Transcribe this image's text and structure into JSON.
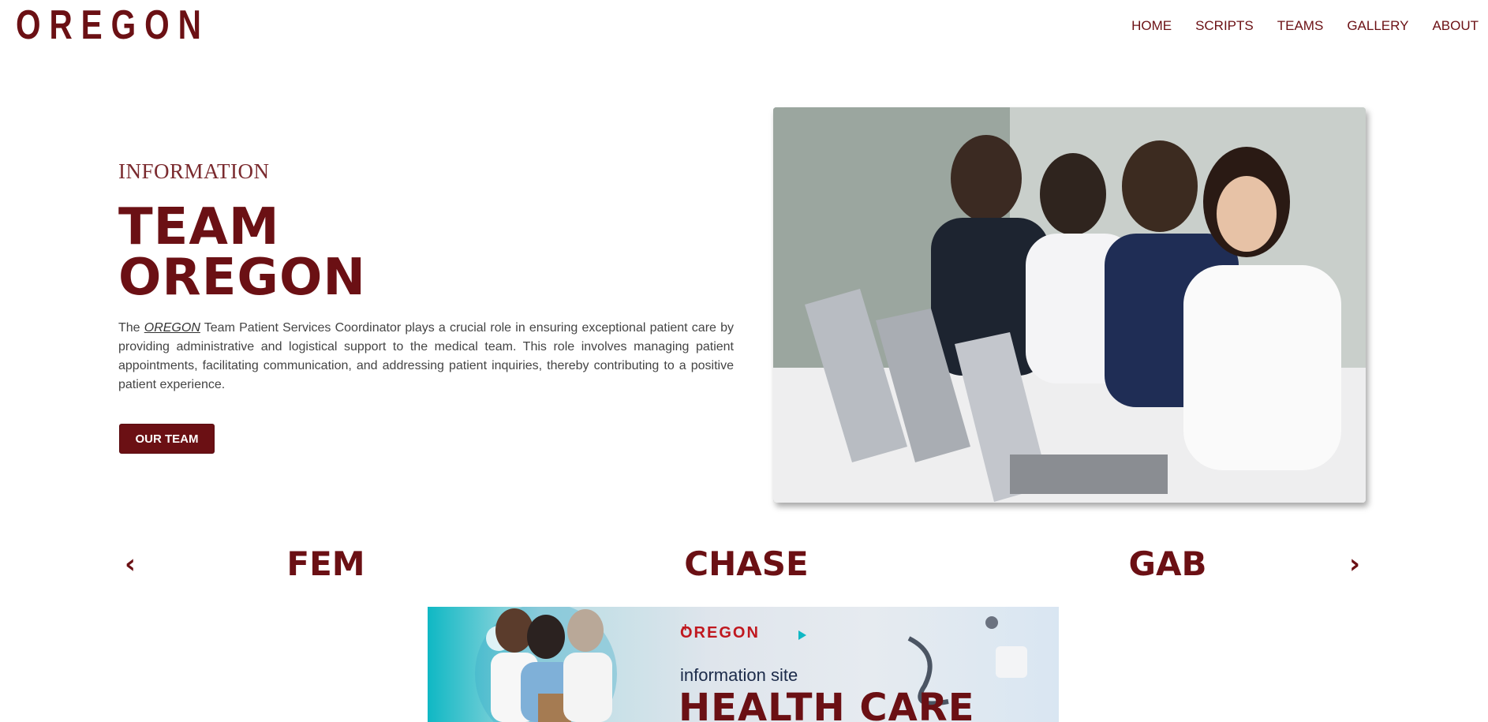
{
  "header": {
    "logo": "OREGON",
    "nav": [
      "HOME",
      "SCRIPTS",
      "TEAMS",
      "GALLERY",
      "ABOUT"
    ]
  },
  "hero": {
    "eyebrow": "INFORMATION",
    "title_line1": "TEAM",
    "title_line2": "OREGON",
    "desc_before": "The ",
    "desc_brand": "OREGON",
    "desc_after": " Team Patient Services Coordinator plays a crucial role in ensuring exceptional patient care by providing administrative and logistical support to the medical team. This role involves managing patient appointments, facilitating communication, and addressing patient inquiries, thereby contributing to a positive patient experience.",
    "button": "OUR TEAM",
    "image_icon": "call-center-photo"
  },
  "carousel": {
    "prev_icon": "chevron-left-icon",
    "next_icon": "chevron-right-icon",
    "items": [
      "FEM",
      "CHASE",
      "GAB"
    ]
  },
  "banner": {
    "brand": "OREGON",
    "subtitle": "information site",
    "title": "HEALTH CARE"
  },
  "colors": {
    "brand": "#6b1014",
    "banner_accent": "#c0181f",
    "banner_teal": "#0fb8c4"
  }
}
